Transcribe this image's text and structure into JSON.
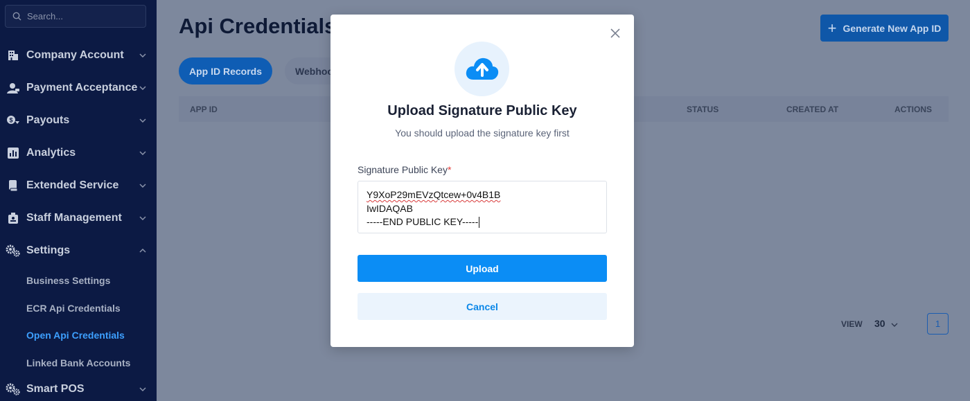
{
  "colors": {
    "sidebar_bg": "#0c1a44",
    "overlay_bg": "#7d889d",
    "primary": "#0b8df5",
    "active_sub": "#3da0ff",
    "required": "#e53935"
  },
  "sidebar": {
    "search_placeholder": "Search...",
    "items": [
      {
        "label": "Company Account",
        "icon": "building-icon",
        "expanded": false
      },
      {
        "label": "Payment Acceptance",
        "icon": "payment-icon",
        "expanded": false
      },
      {
        "label": "Payouts",
        "icon": "payouts-icon",
        "expanded": false
      },
      {
        "label": "Analytics",
        "icon": "analytics-icon",
        "expanded": false
      },
      {
        "label": "Extended Service",
        "icon": "extended-service-icon",
        "expanded": false
      },
      {
        "label": "Staff Management",
        "icon": "staff-icon",
        "expanded": false
      },
      {
        "label": "Settings",
        "icon": "gears-icon",
        "expanded": true
      },
      {
        "label": "Smart POS",
        "icon": "gears-icon",
        "expanded": false
      }
    ],
    "settings_sub": [
      {
        "label": "Business Settings",
        "active": false
      },
      {
        "label": "ECR Api Credentials",
        "active": false
      },
      {
        "label": "Open Api Credentials",
        "active": true
      },
      {
        "label": "Linked Bank Accounts",
        "active": false
      }
    ]
  },
  "main": {
    "title": "Api Credentials",
    "generate_button": "Generate New App ID",
    "tabs": [
      {
        "label": "App ID Records",
        "active": true
      },
      {
        "label": "Webhook",
        "active": false
      }
    ],
    "columns": [
      "APP ID",
      "STATUS",
      "CREATED AT",
      "ACTIONS"
    ],
    "pager": {
      "view_label": "VIEW",
      "page_size": "30",
      "current_page": "1"
    }
  },
  "modal": {
    "title": "Upload Signature Public Key",
    "subtitle": "You should upload the signature key first",
    "field_label": "Signature Public Key",
    "required_mark": "*",
    "key_lines": [
      "Y9XoP29mEVzQtcew+0v4B1B",
      "IwIDAQAB",
      "-----END PUBLIC KEY-----"
    ],
    "upload_button": "Upload",
    "cancel_button": "Cancel"
  }
}
